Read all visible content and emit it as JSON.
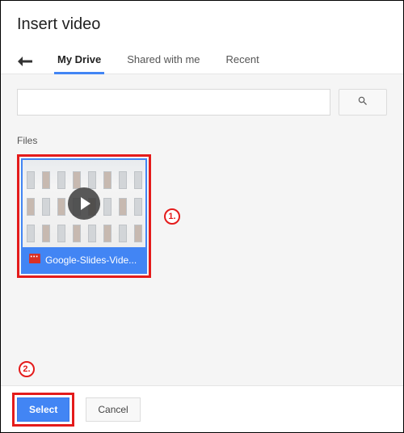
{
  "dialog": {
    "title": "Insert video"
  },
  "tabs": {
    "my_drive": "My Drive",
    "shared": "Shared with me",
    "recent": "Recent"
  },
  "search": {
    "placeholder": ""
  },
  "files_label": "Files",
  "file": {
    "name": "Google-Slides-Vide..."
  },
  "callouts": {
    "one": "1.",
    "two": "2."
  },
  "footer": {
    "select": "Select",
    "cancel": "Cancel"
  }
}
